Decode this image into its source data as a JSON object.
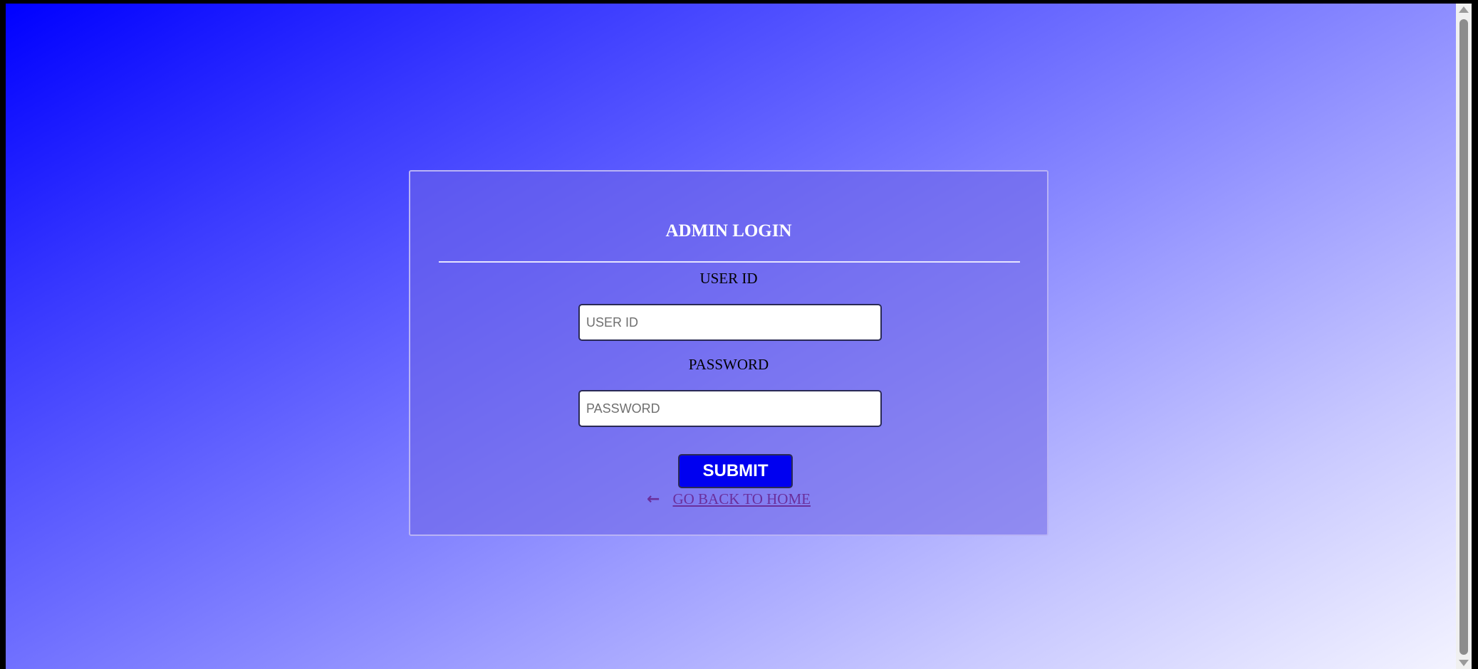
{
  "login": {
    "title": "ADMIN LOGIN",
    "user_id_label": "USER ID",
    "user_id_placeholder": "USER ID",
    "user_id_value": "",
    "password_label": "PASSWORD",
    "password_placeholder": "PASSWORD",
    "password_value": "",
    "submit_label": "SUBMIT",
    "back_icon": "arrow-left-icon",
    "back_label": "GO BACK TO HOME"
  },
  "colors": {
    "gradient_start": "#0000ff",
    "gradient_end": "#f3f3ff",
    "submit_bg": "#0000f0",
    "link": "#6a2f9c",
    "title": "#ffffff"
  }
}
